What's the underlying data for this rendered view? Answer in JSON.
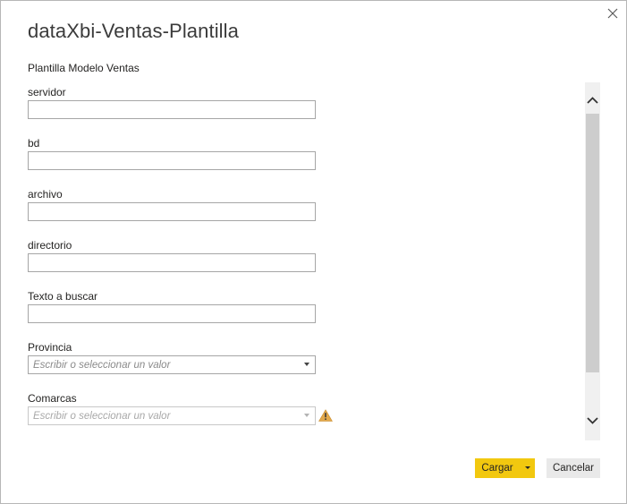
{
  "dialog": {
    "title": "dataXbi-Ventas-Plantilla",
    "subtitle": "Plantilla Modelo Ventas"
  },
  "fields": {
    "servidor": {
      "label": "servidor",
      "value": ""
    },
    "bd": {
      "label": "bd",
      "value": ""
    },
    "archivo": {
      "label": "archivo",
      "value": ""
    },
    "directorio": {
      "label": "directorio",
      "value": ""
    },
    "texto_buscar": {
      "label": "Texto a buscar",
      "value": ""
    },
    "provincia": {
      "label": "Provincia",
      "placeholder": "Escribir o seleccionar un valor"
    },
    "comarcas": {
      "label": "Comarcas",
      "placeholder": "Escribir o seleccionar un valor"
    }
  },
  "buttons": {
    "load_label": "Cargar",
    "cancel_label": "Cancelar"
  },
  "colors": {
    "accent": "#f2c80f",
    "warning": "#e2a84a"
  },
  "icons": {
    "close": "close-icon",
    "warning": "warning-icon",
    "scroll_up": "chevron-up-icon",
    "scroll_down": "chevron-down-icon"
  }
}
